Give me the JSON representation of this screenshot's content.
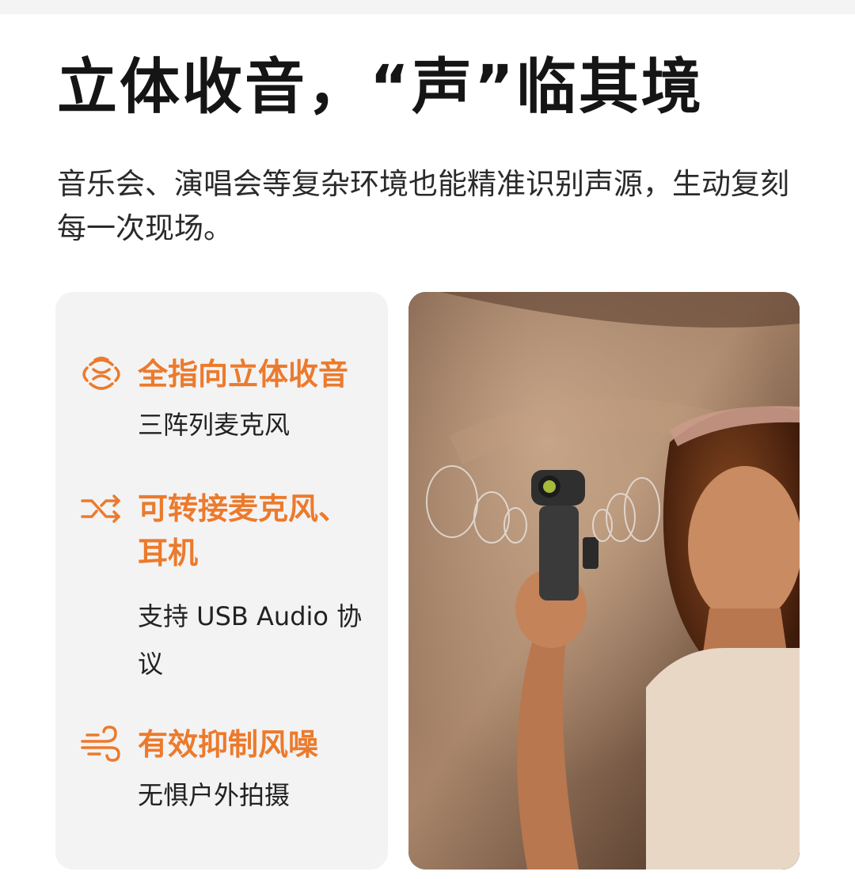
{
  "page": {
    "headline": "立体收音，“声”临其境",
    "subtitle": "音乐会、演唱会等复杂环境也能精准识别声源，生动复刻每一次现场。"
  },
  "features": [
    {
      "title": "全指向立体收音",
      "desc": "三阵列麦克风",
      "icon": "omnidirectional-sound-icon"
    },
    {
      "title": "可转接麦克风、耳机",
      "desc": "支持 USB Audio 协议",
      "icon": "shuffle-connect-icon"
    },
    {
      "title": "有效抑制风噪",
      "desc": "无惧户外拍摄",
      "icon": "wind-icon"
    }
  ],
  "colors": {
    "accent": "#ec7a2c",
    "card_background": "#f3f3f3"
  }
}
